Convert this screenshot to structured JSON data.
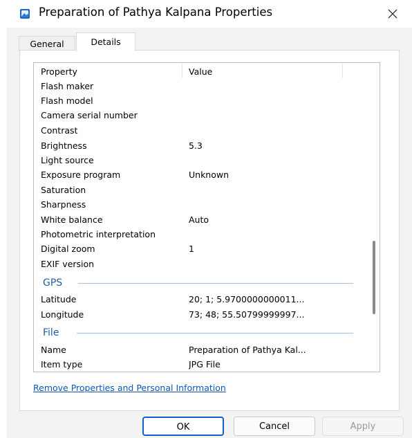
{
  "window": {
    "title": "Preparation of Pathya Kalpana Properties",
    "icon": "image-file-icon",
    "close_glyph": "✕"
  },
  "tabs": [
    {
      "label": "General",
      "selected": false
    },
    {
      "label": "Details",
      "selected": true
    }
  ],
  "columns": {
    "property": "Property",
    "value": "Value"
  },
  "rows": [
    {
      "k": "Flash maker",
      "v": ""
    },
    {
      "k": "Flash model",
      "v": ""
    },
    {
      "k": "Camera serial number",
      "v": ""
    },
    {
      "k": "Contrast",
      "v": ""
    },
    {
      "k": "Brightness",
      "v": "5.3"
    },
    {
      "k": "Light source",
      "v": ""
    },
    {
      "k": "Exposure program",
      "v": "Unknown"
    },
    {
      "k": "Saturation",
      "v": ""
    },
    {
      "k": "Sharpness",
      "v": ""
    },
    {
      "k": "White balance",
      "v": "Auto"
    },
    {
      "k": "Photometric interpretation",
      "v": ""
    },
    {
      "k": "Digital zoom",
      "v": "1"
    },
    {
      "k": "EXIF version",
      "v": ""
    }
  ],
  "groups": {
    "gps": {
      "label": "GPS",
      "rows": [
        {
          "k": "Latitude",
          "v": "20; 1; 5.9700000000011..."
        },
        {
          "k": "Longitude",
          "v": "73; 48; 55.50799999997..."
        }
      ]
    },
    "file": {
      "label": "File",
      "rows": [
        {
          "k": "Name",
          "v": "Preparation of Pathya Kal..."
        },
        {
          "k": "Item type",
          "v": "JPG File"
        }
      ]
    }
  },
  "link": "Remove Properties and Personal Information",
  "buttons": {
    "ok": "OK",
    "cancel": "Cancel",
    "apply": "Apply"
  },
  "colors": {
    "accent": "#0a63c9",
    "link": "#0a58b8",
    "group_header": "#1f5ea8"
  }
}
